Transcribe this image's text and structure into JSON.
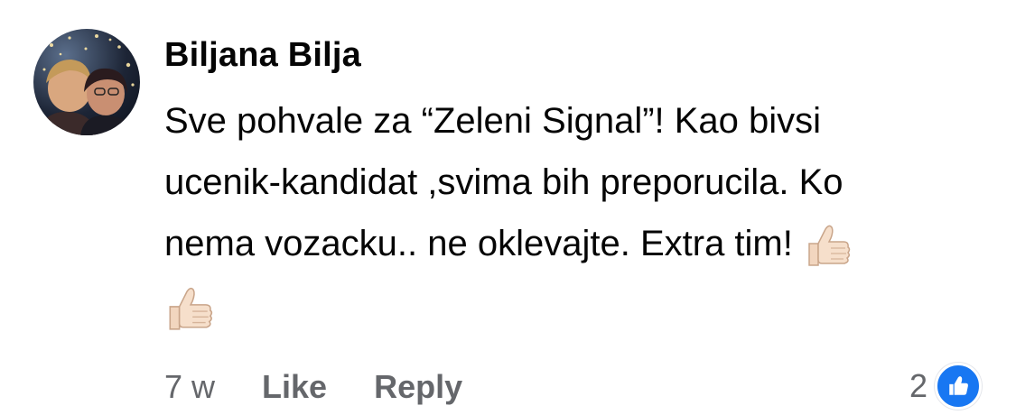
{
  "comment": {
    "author": "Biljana Bilja",
    "text_lines": [
      "Sve pohvale za “Zeleni Signal”! Kao bivsi",
      "ucenik-kandidat ,svima bih preporucila. Ko",
      "nema vozacku.. ne oklevajte. Extra tim!"
    ],
    "emoji": [
      "thumbs-up-icon",
      "thumbs-up-icon"
    ],
    "colors": {
      "text": "#050505",
      "secondary": "#65676b",
      "like_blue": "#1877f2"
    }
  },
  "actions": {
    "time": "7 w",
    "like_label": "Like",
    "reply_label": "Reply"
  },
  "reactions": {
    "count": "2",
    "icon": "like-reaction-icon"
  }
}
